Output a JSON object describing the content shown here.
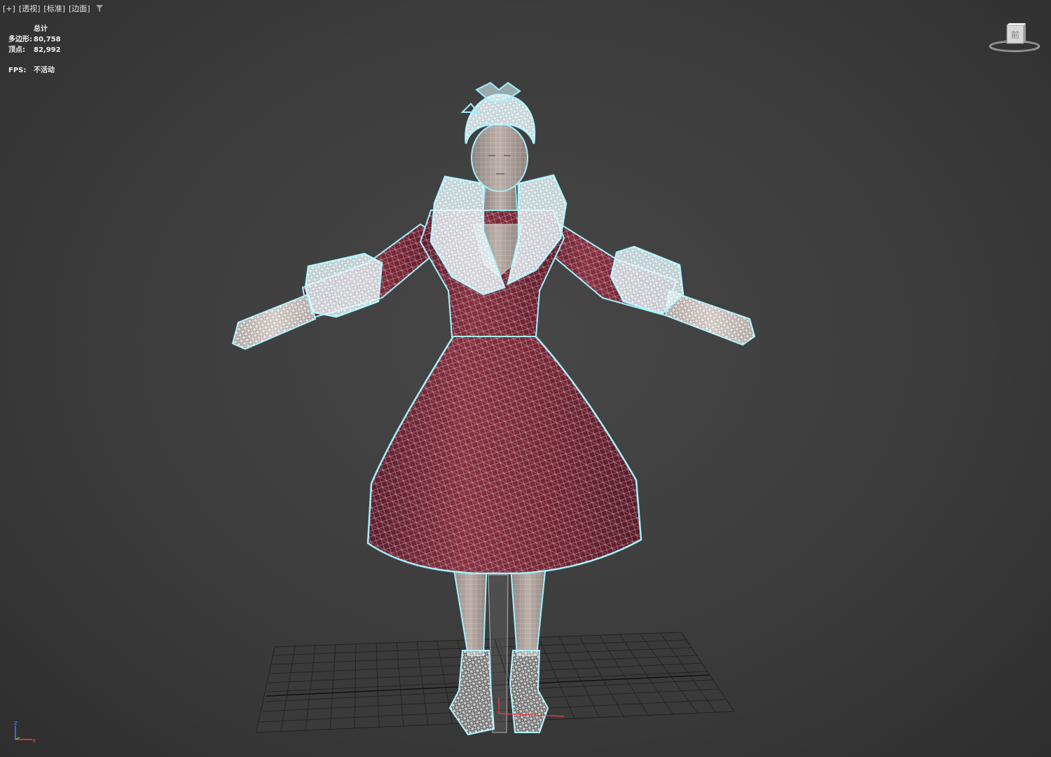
{
  "viewport": {
    "labels": [
      "[+]",
      "[透视]",
      "[标准]",
      "[边面]"
    ]
  },
  "stats": {
    "header": "总计",
    "polygons_label": "多边形:",
    "polygons_value": "80,758",
    "vertices_label": "顶点:",
    "vertices_value": "82,992",
    "fps_label": "FPS:",
    "fps_value": "不活动"
  },
  "viewcube": {
    "face_label": "前"
  },
  "axis": {
    "z_label": "z",
    "x_label": "x"
  },
  "colors": {
    "background": "#3b3b3b",
    "wireframe_selected": "#9ff0ff",
    "dress": "#7a2a3c",
    "skin": "#b9a9a2",
    "grid": "#222222"
  }
}
